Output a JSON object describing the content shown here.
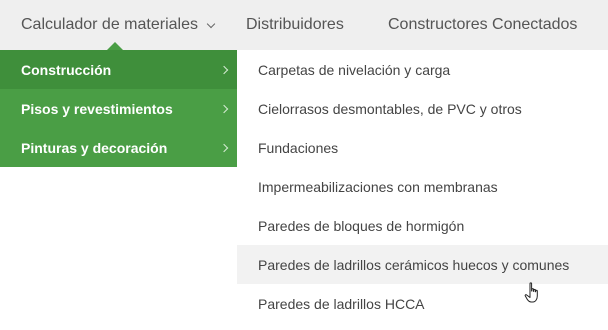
{
  "nav": {
    "calculador": "Calculador de materiales",
    "distribuidores": "Distribuidores",
    "constructores": "Constructores Conectados"
  },
  "categories": [
    {
      "label": "Construcción"
    },
    {
      "label": "Pisos y revestimientos"
    },
    {
      "label": "Pinturas y decoración"
    }
  ],
  "submenu": [
    {
      "label": "Carpetas de nivelación y carga"
    },
    {
      "label": "Cielorrasos desmontables, de PVC y otros"
    },
    {
      "label": "Fundaciones"
    },
    {
      "label": "Impermeabilizaciones con membranas"
    },
    {
      "label": "Paredes de bloques de hormigón"
    },
    {
      "label": "Paredes de ladrillos cerámicos huecos y comunes"
    },
    {
      "label": "Paredes de ladrillos HCCA"
    }
  ],
  "colors": {
    "menu_green": "#4a9e45",
    "topbar": "#efefef"
  },
  "icons": [
    "chevron-down-icon",
    "chevron-right-icon",
    "hand-pointer-icon"
  ]
}
